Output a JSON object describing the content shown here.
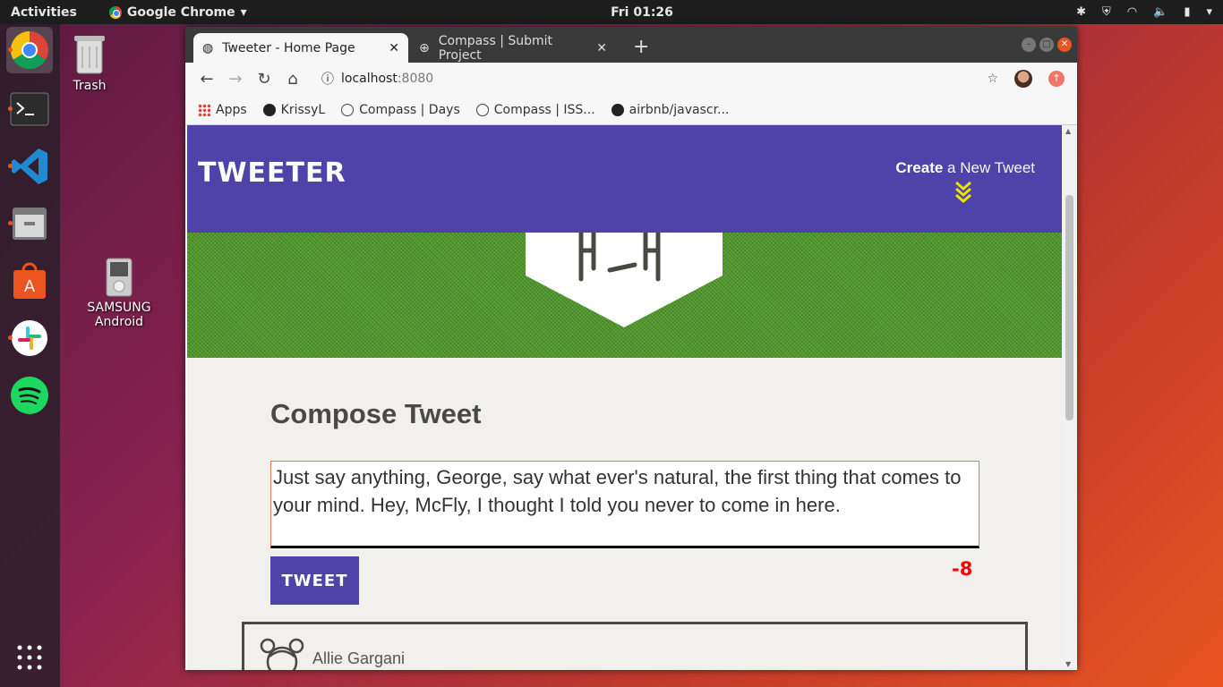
{
  "topbar": {
    "activities": "Activities",
    "app_name": "Google Chrome",
    "clock": "Fri 01:26"
  },
  "desktop": {
    "trash_label": "Trash",
    "device_label_1": "SAMSUNG",
    "device_label_2": "Android"
  },
  "browser": {
    "tabs": [
      {
        "label": "Tweeter - Home Page"
      },
      {
        "label": "Compass | Submit Project"
      }
    ],
    "url_host": "localhost",
    "url_port": ":8080",
    "bookmarks": [
      {
        "label": "Apps"
      },
      {
        "label": "KrissyL"
      },
      {
        "label": "Compass | Days"
      },
      {
        "label": "Compass | ISS..."
      },
      {
        "label": "airbnb/javascr..."
      }
    ]
  },
  "site": {
    "brand": "TWEETER",
    "compose_link_bold": "Create",
    "compose_link_rest": " a New Tweet",
    "compose_title": "Compose Tweet",
    "tweet_text": "Just say anything, George, say what ever's natural, the first thing that comes to your mind. Hey, McFly, I thought I told you never to come in here.",
    "tweet_button": "TWEET",
    "char_counter": "-8",
    "tweets": [
      {
        "author": "Allie Gargani"
      }
    ]
  },
  "colors": {
    "header": "#4f42a8",
    "banner": "#4f9a2b",
    "counter": "#ff0000",
    "ubuntu_accent": "#e95420"
  }
}
